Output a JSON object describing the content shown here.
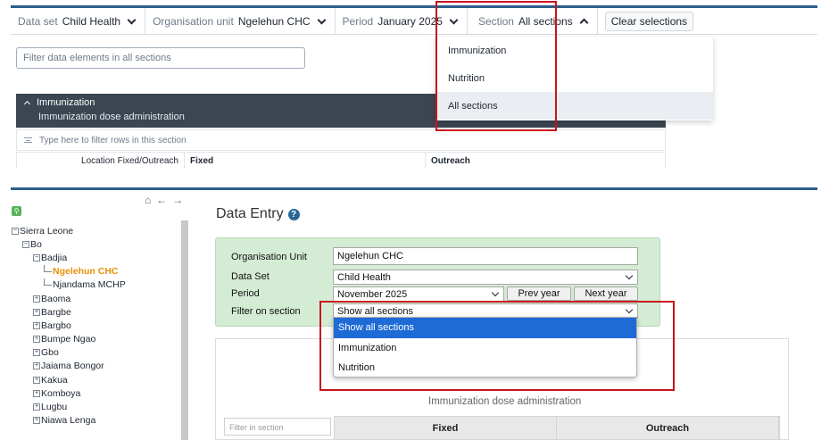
{
  "top_app": {
    "context_bar": {
      "data_set": {
        "label": "Data set",
        "value": "Child Health"
      },
      "org_unit": {
        "label": "Organisation unit",
        "value": "Ngelehun CHC"
      },
      "period": {
        "label": "Period",
        "value": "January 2025"
      },
      "section": {
        "label": "Section",
        "value": "All sections"
      },
      "clear_label": "Clear selections"
    },
    "filter_placeholder": "Filter data elements in all sections",
    "section_dropdown": {
      "options": [
        "Immunization",
        "Nutrition",
        "All sections"
      ],
      "selected": "All sections"
    },
    "section_panel": {
      "title": "Immunization",
      "description": "Immunization dose administration",
      "row_filter_placeholder": "Type here to filter rows in this section",
      "columns": [
        "Location Fixed/Outreach",
        "Fixed",
        "Outreach"
      ]
    },
    "highlight_color": "#c8141d",
    "header_color": "#3b4652"
  },
  "bottom_app": {
    "tree": [
      {
        "label": "Sierra Leone",
        "level": 0,
        "state": "expanded"
      },
      {
        "label": "Bo",
        "level": 1,
        "state": "expanded"
      },
      {
        "label": "Badjia",
        "level": 2,
        "state": "expanded"
      },
      {
        "label": "Ngelehun CHC",
        "level": 3,
        "state": "leaf",
        "selected": true
      },
      {
        "label": "Njandama MCHP",
        "level": 3,
        "state": "leaf"
      },
      {
        "label": "Baoma",
        "level": 2,
        "state": "collapsed"
      },
      {
        "label": "Bargbe",
        "level": 2,
        "state": "collapsed"
      },
      {
        "label": "Bargbo",
        "level": 2,
        "state": "collapsed"
      },
      {
        "label": "Bumpe Ngao",
        "level": 2,
        "state": "collapsed"
      },
      {
        "label": "Gbo",
        "level": 2,
        "state": "collapsed"
      },
      {
        "label": "Jaiama Bongor",
        "level": 2,
        "state": "collapsed"
      },
      {
        "label": "Kakua",
        "level": 2,
        "state": "collapsed"
      },
      {
        "label": "Komboya",
        "level": 2,
        "state": "collapsed"
      },
      {
        "label": "Lugbu",
        "level": 2,
        "state": "collapsed"
      },
      {
        "label": "Niawa Lenga",
        "level": 2,
        "state": "collapsed"
      }
    ],
    "page_title": "Data Entry",
    "form": {
      "org_unit_label": "Organisation Unit",
      "org_unit_value": "Ngelehun CHC",
      "data_set_label": "Data Set",
      "data_set_value": "Child Health",
      "period_label": "Period",
      "period_value": "November 2025",
      "prev_year": "Prev year",
      "next_year": "Next year",
      "filter_label": "Filter on section",
      "filter_value": "Show all sections"
    },
    "section_select_options": [
      "Show all sections",
      "Immunization",
      "Nutrition"
    ],
    "section_description": "Immunization dose administration",
    "filter_in_section_placeholder": "Filter in section",
    "table_columns": [
      "Fixed",
      "Outreach"
    ],
    "selected_color": "#e8900b",
    "form_bg": "#d4ecd4"
  }
}
